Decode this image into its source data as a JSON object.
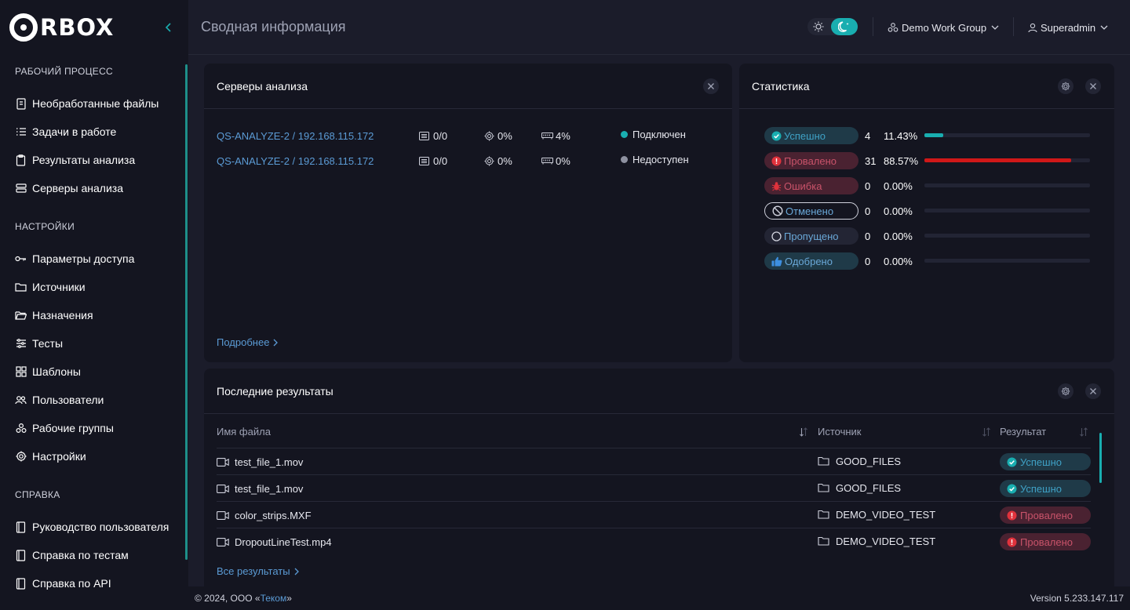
{
  "brand": {
    "logo_text": "RBOX"
  },
  "header": {
    "title": "Сводная информация",
    "workgroup": "Demo Work Group",
    "user": "Superadmin"
  },
  "sidebar": {
    "sections": [
      {
        "title": "Рабочий процесс",
        "items": [
          "Необработанные файлы",
          "Задачи в работе",
          "Результаты анализа",
          "Серверы анализа"
        ]
      },
      {
        "title": "Настройки",
        "items": [
          "Параметры доступа",
          "Источники",
          "Назначения",
          "Тесты",
          "Шаблоны",
          "Пользователи",
          "Рабочие группы",
          "Настройки"
        ]
      },
      {
        "title": "Справка",
        "items": [
          "Руководство пользователя",
          "Справка по тестам",
          "Справка по API"
        ]
      }
    ],
    "icons": [
      "file-icon",
      "list-icon",
      "clipboard-icon",
      "server-icon",
      "key-icon",
      "folder-icon",
      "folder-open-icon",
      "sliders-icon",
      "template-icon",
      "users-icon",
      "groups-icon",
      "gear-icon",
      "book-icon",
      "book-icon",
      "book-icon"
    ]
  },
  "servers": {
    "title": "Серверы анализа",
    "more": "Подробнее",
    "rows": [
      {
        "name": "QS-ANALYZE-2 / 192.168.115.172",
        "tasks": "0/0",
        "cpu": "0%",
        "mem": "4%",
        "status": "Подключен",
        "status_color": "#19aeb0"
      },
      {
        "name": "QS-ANALYZE-2 / 192.168.115.172",
        "tasks": "0/0",
        "cpu": "0%",
        "mem": "0%",
        "status": "Недоступен",
        "status_color": "#8e91a0"
      }
    ]
  },
  "stats": {
    "title": "Статистика",
    "rows": [
      {
        "label": "Успешно",
        "count": "4",
        "pct": "11.43%",
        "fraction": 0.1143,
        "bg": "#1f3a48",
        "fg": "#3fa1c5",
        "bar": "#19aeb0",
        "icon": "check-circle-icon"
      },
      {
        "label": "Провалено",
        "count": "31",
        "pct": "88.57%",
        "fraction": 0.8857,
        "bg": "#4a2231",
        "fg": "#c9536a",
        "bar": "#d01818",
        "icon": "alert-circle-icon"
      },
      {
        "label": "Ошибка",
        "count": "0",
        "pct": "0.00%",
        "fraction": 0,
        "bg": "#4a2231",
        "fg": "#c9536a",
        "bar": "#d01818",
        "icon": "bug-icon"
      },
      {
        "label": "Отменено",
        "count": "0",
        "pct": "0.00%",
        "fraction": 0,
        "bg": "#141520",
        "fg": "#6aa8d8",
        "bar": "#8e91a0",
        "icon": "ban-icon"
      },
      {
        "label": "Пропущено",
        "count": "0",
        "pct": "0.00%",
        "fraction": 0,
        "bg": "#232534",
        "fg": "#6aa8d8",
        "bar": "#8e91a0",
        "icon": "circle-icon"
      },
      {
        "label": "Одобрено",
        "count": "0",
        "pct": "0.00%",
        "fraction": 0,
        "bg": "#1f3a48",
        "fg": "#6aa8d8",
        "bar": "#19aeb0",
        "icon": "thumbs-up-icon"
      }
    ]
  },
  "results": {
    "title": "Последние результаты",
    "columns": [
      "Имя файла",
      "Источник",
      "Результат"
    ],
    "all_link": "Все результаты",
    "rows": [
      {
        "file": "test_file_1.mov",
        "source": "GOOD_FILES",
        "result": "Успешно",
        "ok": true
      },
      {
        "file": "test_file_1.mov",
        "source": "GOOD_FILES",
        "result": "Успешно",
        "ok": true
      },
      {
        "file": "color_strips.MXF",
        "source": "DEMO_VIDEO_TEST",
        "result": "Провалено",
        "ok": false
      },
      {
        "file": "DropoutLineTest.mp4",
        "source": "DEMO_VIDEO_TEST",
        "result": "Провалено",
        "ok": false
      }
    ]
  },
  "footer": {
    "copyright_prefix": "© 2024, ООО «",
    "company": "Теком",
    "copyright_suffix": "»",
    "version": "Version 5.233.147.117"
  },
  "colors": {
    "accent": "#19aeb0",
    "link": "#5b9bd5",
    "fail": "#d01818"
  }
}
